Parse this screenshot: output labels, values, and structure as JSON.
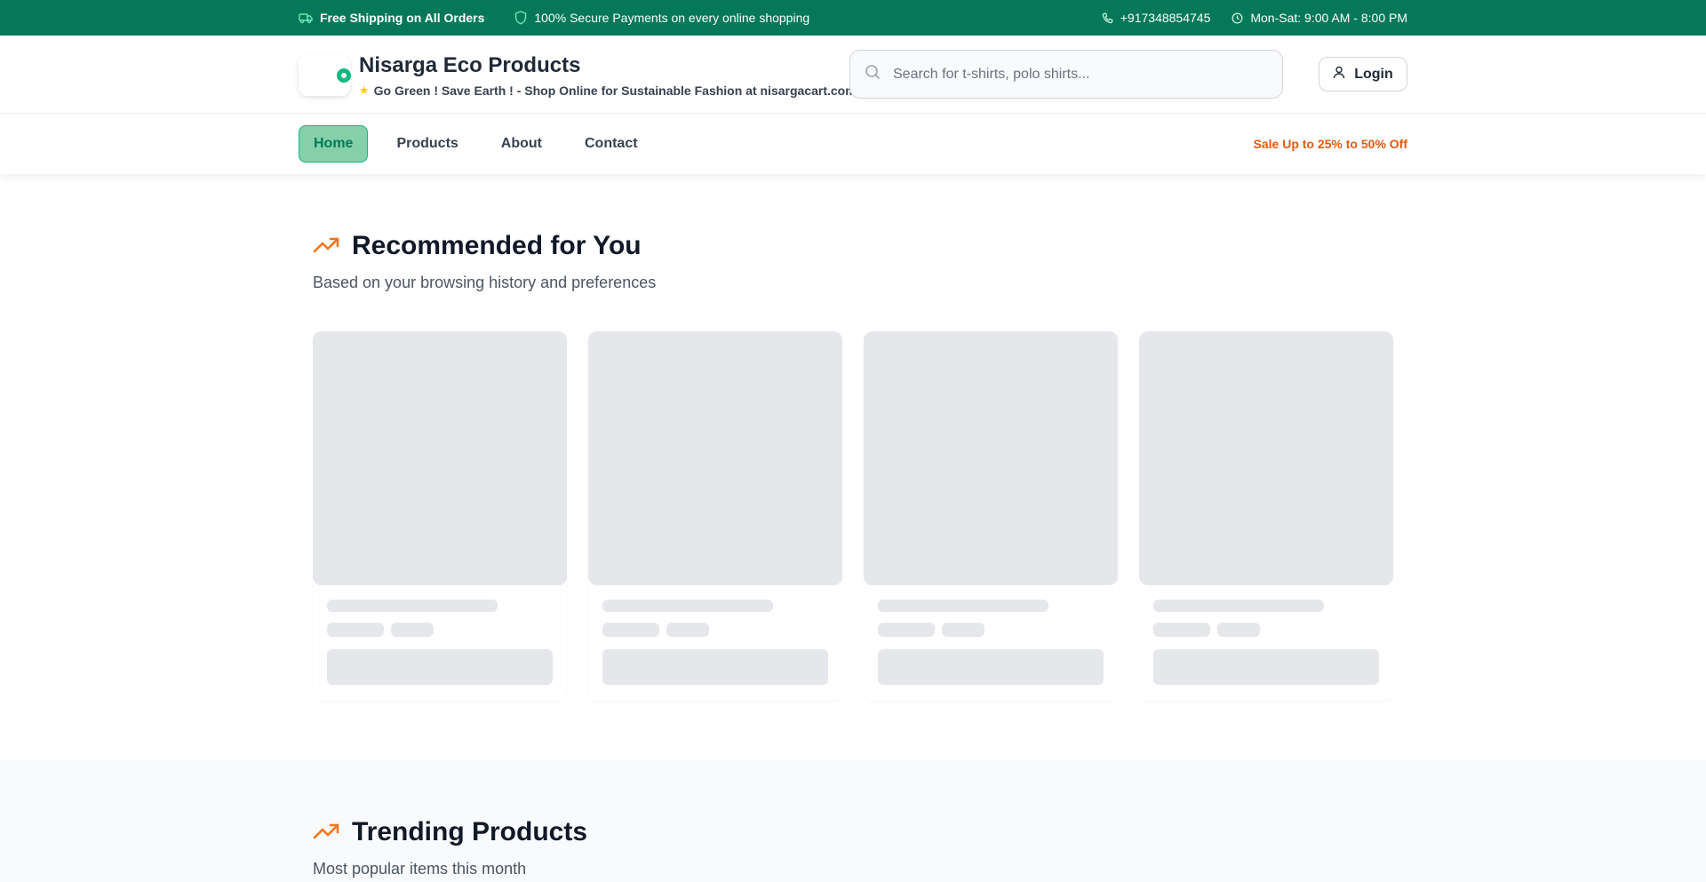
{
  "topbar": {
    "shipping": "Free Shipping on All Orders",
    "secure": "100% Secure Payments on every online shopping",
    "phone": "+917348854745",
    "hours": "Mon-Sat: 9:00 AM - 8:00 PM"
  },
  "header": {
    "brand_name": "Nisarga Eco Products",
    "tagline": "Go Green ! Save Earth ! - Shop Online for Sustainable Fashion at nisargacart.com",
    "search_placeholder": "Search for t-shirts, polo shirts...",
    "login_label": "Login"
  },
  "nav": {
    "items": [
      {
        "label": "Home",
        "active": true
      },
      {
        "label": "Products",
        "active": false
      },
      {
        "label": "About",
        "active": false
      },
      {
        "label": "Contact",
        "active": false
      }
    ],
    "sale_text": "Sale Up to 25% to 50% Off"
  },
  "recommended": {
    "title": "Recommended for You",
    "subtitle": "Based on your browsing history and preferences",
    "loading_cards": 4
  },
  "trending": {
    "title": "Trending Products",
    "subtitle": "Most popular items this month"
  },
  "colors": {
    "brand_green": "#047857",
    "accent_orange": "#ea580c",
    "active_nav_bg": "#86d0a9",
    "skeleton": "#e5e7eb"
  },
  "icons": [
    "truck-icon",
    "shield-icon",
    "phone-icon",
    "clock-icon",
    "star-icon",
    "search-icon",
    "user-icon",
    "trending-up-icon"
  ]
}
